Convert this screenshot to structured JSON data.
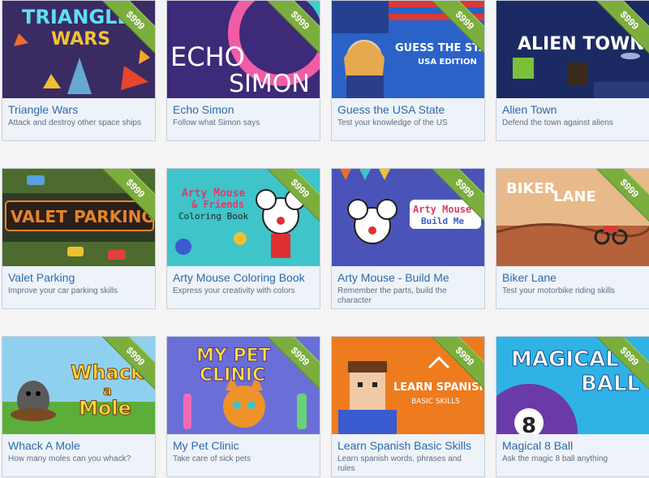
{
  "games": [
    {
      "title": "Triangle Wars",
      "desc": "Attack and destroy other space ships",
      "price": "$999",
      "thumb_text": [
        "TRIANGLE",
        "WARS"
      ]
    },
    {
      "title": "Echo Simon",
      "desc": "Follow what Simon says",
      "price": "$999",
      "thumb_text": [
        "ECHO",
        "SIMON"
      ]
    },
    {
      "title": "Guess the USA State",
      "desc": "Test your knowledge of the US",
      "price": "$999",
      "thumb_text": [
        "GUESS THE STATE",
        "USA EDITION"
      ]
    },
    {
      "title": "Alien Town",
      "desc": "Defend the town against aliens",
      "price": "$999",
      "thumb_text": [
        "ALIEN TOWN"
      ]
    },
    {
      "title": "Valet Parking",
      "desc": "Improve your car parking skills",
      "price": "$999",
      "thumb_text": [
        "VALET",
        "PARKING"
      ]
    },
    {
      "title": "Arty Mouse Coloring Book",
      "desc": "Express your creativity with colors",
      "price": "$999",
      "thumb_text": [
        "Arty Mouse",
        "& Friends",
        "Coloring Book"
      ]
    },
    {
      "title": "Arty Mouse - Build Me",
      "desc": "Remember the parts, build the character",
      "price": "$999",
      "thumb_text": [
        "Arty Mouse",
        "Build Me"
      ]
    },
    {
      "title": "Biker Lane",
      "desc": "Test your motorbike riding skills",
      "price": "$999",
      "thumb_text": [
        "BIKER",
        "LANE"
      ]
    },
    {
      "title": "Whack A Mole",
      "desc": "How many moles can you whack?",
      "price": "$999",
      "thumb_text": [
        "Whack",
        "a",
        "Mole"
      ]
    },
    {
      "title": "My Pet Clinic",
      "desc": "Take care of sick pets",
      "price": "$999",
      "thumb_text": [
        "MY PET",
        "CLINIC"
      ]
    },
    {
      "title": "Learn Spanish Basic Skills",
      "desc": "Learn spanish words, phrases and rules",
      "price": "$999",
      "thumb_text": [
        "LEARN SPANISH",
        "BASIC SKILLS"
      ]
    },
    {
      "title": "Magical 8 Ball",
      "desc": "Ask the magic 8 ball anything",
      "price": "$999",
      "thumb_text": [
        "MAGICAL",
        "BALL",
        "8"
      ]
    }
  ]
}
